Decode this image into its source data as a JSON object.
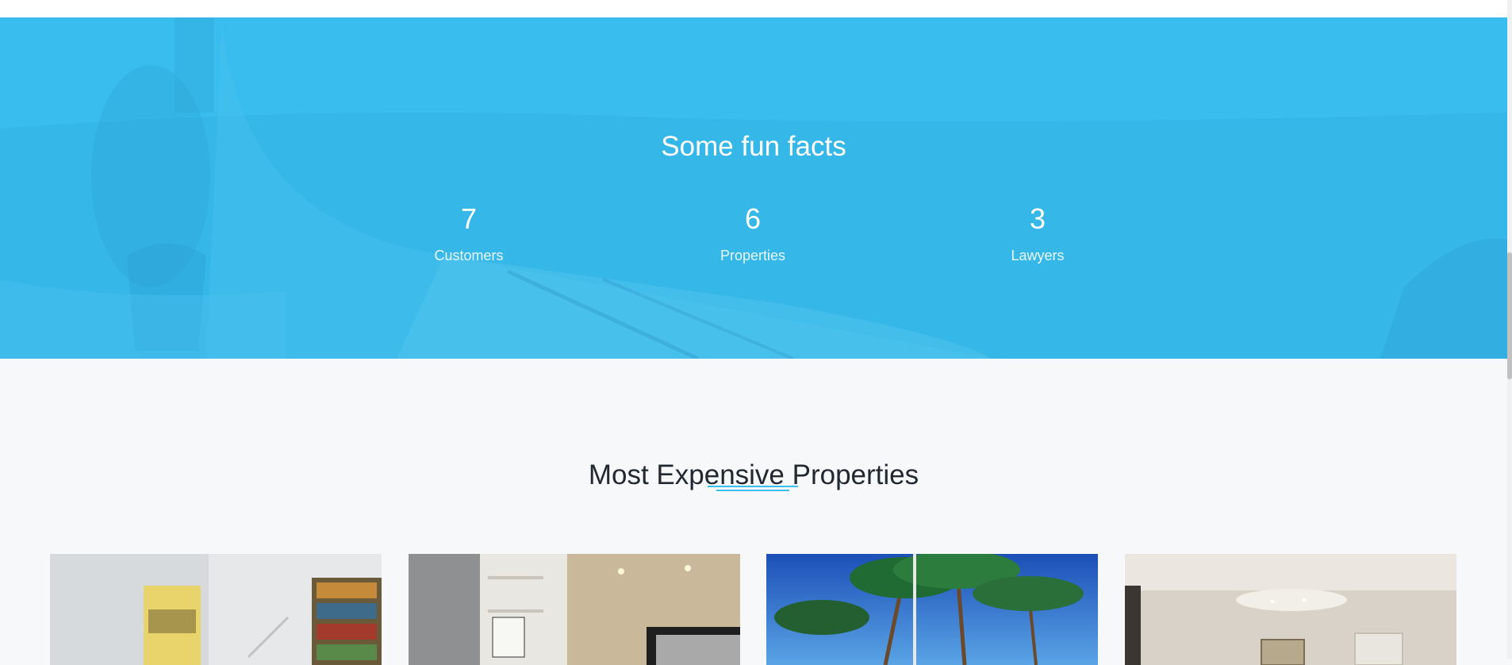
{
  "fun_facts": {
    "title": "Some fun facts",
    "items": [
      {
        "value": "7",
        "label": "Customers"
      },
      {
        "value": "6",
        "label": "Properties"
      },
      {
        "value": "3",
        "label": "Lawyers"
      }
    ]
  },
  "properties": {
    "title": "Most Expensive Properties",
    "cards": [
      {
        "image": "white-room-with-bookshelf"
      },
      {
        "image": "living-room-with-shelves"
      },
      {
        "image": "palm-trees-blue-sky"
      },
      {
        "image": "beige-interior-room"
      }
    ]
  },
  "colors": {
    "accent": "#38bdee",
    "section_bg": "#f7f8fa",
    "heading_text": "#222831"
  }
}
